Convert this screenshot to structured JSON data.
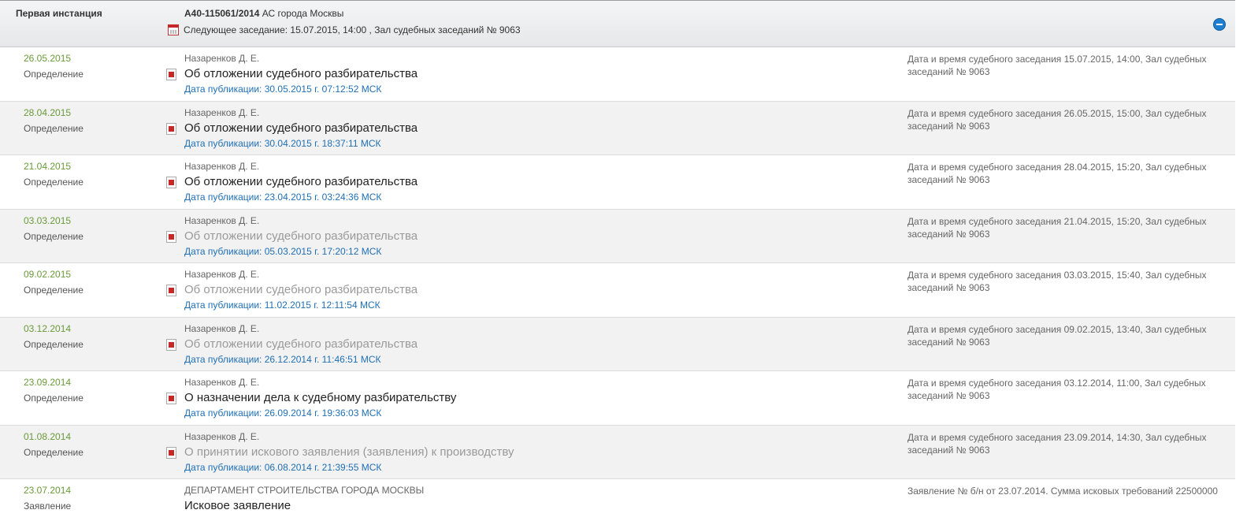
{
  "header": {
    "instance": "Первая инстанция",
    "case_number": "А40-115061/2014",
    "court": " АС города Москвы",
    "next_session": "Следующее заседание: 15.07.2015, 14:00 , Зал судебных заседаний № 9063"
  },
  "rows": [
    {
      "date": "26.05.2015",
      "type": "Определение",
      "author": "Назаренков Д. Е.",
      "title": "Об отложении судебного разбирательства",
      "publication": "Дата публикации: 30.05.2015 г. 07:12:52 МСК",
      "info": "Дата и время судебного заседания 15.07.2015, 14:00, Зал судебных заседаний № 9063"
    },
    {
      "date": "28.04.2015",
      "type": "Определение",
      "author": "Назаренков Д. Е.",
      "title": "Об отложении судебного разбирательства",
      "publication": "Дата публикации: 30.04.2015 г. 18:37:11 МСК",
      "info": "Дата и время судебного заседания 26.05.2015, 15:00, Зал судебных заседаний № 9063"
    },
    {
      "date": "21.04.2015",
      "type": "Определение",
      "author": "Назаренков Д. Е.",
      "title": "Об отложении судебного разбирательства",
      "publication": "Дата публикации: 23.04.2015 г. 03:24:36 МСК",
      "info": "Дата и время судебного заседания 28.04.2015, 15:20, Зал судебных заседаний № 9063"
    },
    {
      "date": "03.03.2015",
      "type": "Определение",
      "author": "Назаренков Д. Е.",
      "title": "Об отложении судебного разбирательства",
      "publication": "Дата публикации: 05.03.2015 г. 17:20:12 МСК",
      "info": "Дата и время судебного заседания 21.04.2015, 15:20, Зал судебных заседаний № 9063"
    },
    {
      "date": "09.02.2015",
      "type": "Определение",
      "author": "Назаренков Д. Е.",
      "title": "Об отложении судебного разбирательства",
      "publication": "Дата публикации: 11.02.2015 г. 12:11:54 МСК",
      "info": "Дата и время судебного заседания 03.03.2015, 15:40, Зал судебных заседаний № 9063"
    },
    {
      "date": "03.12.2014",
      "type": "Определение",
      "author": "Назаренков Д. Е.",
      "title": "Об отложении судебного разбирательства",
      "publication": "Дата публикации: 26.12.2014 г. 11:46:51 МСК",
      "info": "Дата и время судебного заседания 09.02.2015, 13:40, Зал судебных заседаний № 9063"
    },
    {
      "date": "23.09.2014",
      "type": "Определение",
      "author": "Назаренков Д. Е.",
      "title": "О назначении дела к судебному разбирательству",
      "publication": "Дата публикации: 26.09.2014 г. 19:36:03 МСК",
      "info": "Дата и время судебного заседания 03.12.2014, 11:00, Зал судебных заседаний № 9063"
    },
    {
      "date": "01.08.2014",
      "type": "Определение",
      "author": "Назаренков Д. Е.",
      "title": "О принятии искового заявления (заявления) к производству",
      "publication": "Дата публикации: 06.08.2014 г. 21:39:55 МСК",
      "info": "Дата и время судебного заседания 23.09.2014, 14:30, Зал судебных заседаний № 9063"
    },
    {
      "date": "23.07.2014",
      "type": "Заявление",
      "author": "ДЕПАРТАМЕНТ СТРОИТЕЛЬСТВА ГОРОДА МОСКВЫ",
      "title": "Исковое заявление",
      "info": "Заявление № б/н от 23.07.2014. Сумма исковых требований 22500000"
    }
  ]
}
